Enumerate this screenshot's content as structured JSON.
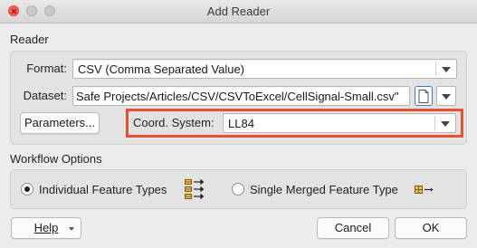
{
  "window": {
    "title": "Add Reader"
  },
  "reader_section": {
    "label": "Reader",
    "format": {
      "label": "Format:",
      "value": "CSV (Comma Separated Value)"
    },
    "dataset": {
      "label": "Dataset:",
      "value": "Safe Projects/Articles/CSV/CSVToExcel/CellSignal-Small.csv\""
    },
    "parameters_button": "Parameters...",
    "coord_system": {
      "label": "Coord. System:",
      "value": "LL84"
    }
  },
  "workflow_section": {
    "label": "Workflow Options",
    "option_individual": "Individual Feature Types",
    "option_single": "Single Merged Feature Type",
    "selected": "Individual Feature Types"
  },
  "footer": {
    "help_label": "Help",
    "cancel_label": "Cancel",
    "ok_label": "OK"
  },
  "colors": {
    "highlight": "#e8512b",
    "accent": "#2d7fd4"
  },
  "icons": [
    "close-icon",
    "minimize-icon",
    "maximize-icon",
    "file-browse-icon",
    "feature-types-multi-icon",
    "feature-type-single-icon"
  ]
}
